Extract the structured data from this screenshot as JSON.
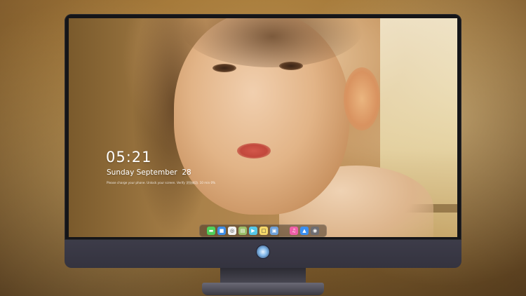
{
  "lockscreen": {
    "time": "05:21",
    "date": "Sunday September  28",
    "note": "Please charge your phone. Unlock your screen. Verify 识别成功. 10 min 0%"
  },
  "dock": {
    "apps": [
      {
        "name": "messages-icon",
        "glyph": "▬",
        "color": "#4fd05a"
      },
      {
        "name": "finder-icon",
        "glyph": "■",
        "color": "#3f8ee6"
      },
      {
        "name": "safari-icon",
        "glyph": "◎",
        "color": "#f2f2f2"
      },
      {
        "name": "preview-icon",
        "glyph": "▤",
        "color": "#9bbf6a"
      },
      {
        "name": "video-editor-icon",
        "glyph": "▶",
        "color": "#55c7e8"
      },
      {
        "name": "notes-icon",
        "glyph": "□",
        "color": "#f5d86a"
      },
      {
        "name": "photos-icon",
        "glyph": "▣",
        "color": "#6fa1d8"
      },
      {
        "name": "music-icon",
        "glyph": "♫",
        "color": "#ef5fa8"
      },
      {
        "name": "app-store-icon",
        "glyph": "▲",
        "color": "#3a8ef0"
      },
      {
        "name": "camera-icon",
        "glyph": "◉",
        "color": "#6d6d72"
      }
    ]
  },
  "colors": {
    "monitor_bezel": "#151518",
    "monitor_chin": "#3d3c49",
    "text": "#ffffff"
  }
}
